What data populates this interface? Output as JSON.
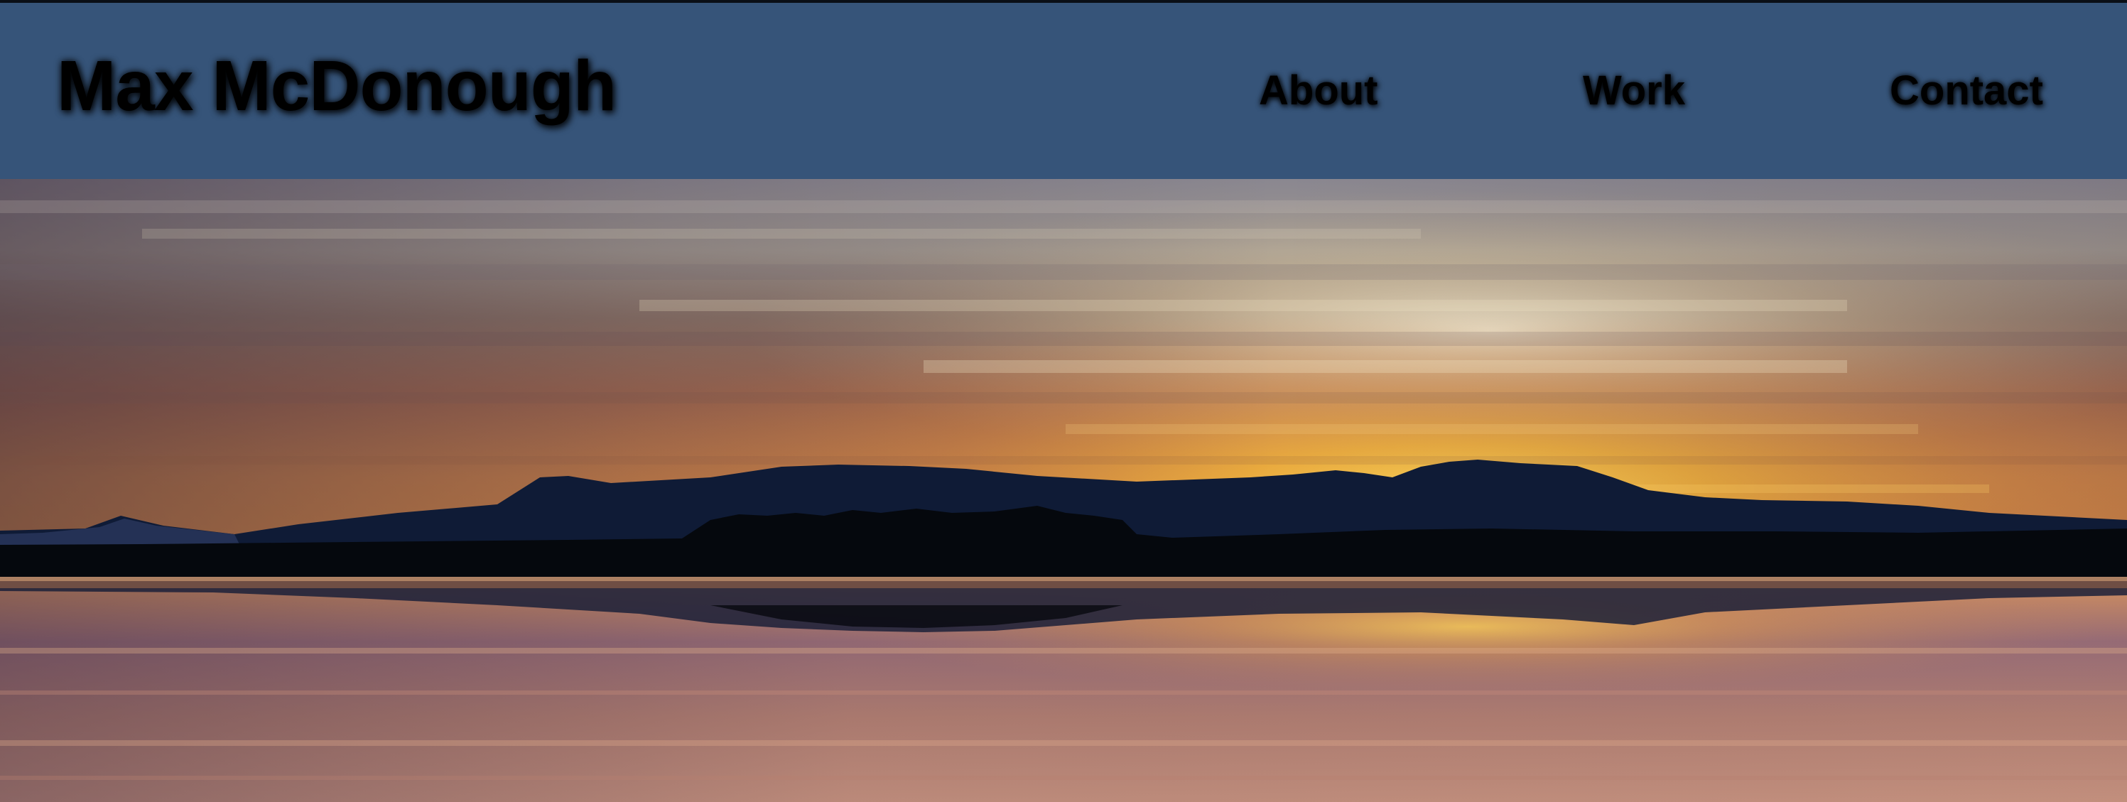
{
  "site": {
    "title": "Max McDonough"
  },
  "nav": {
    "items": [
      {
        "label": "About"
      },
      {
        "label": "Work"
      },
      {
        "label": "Contact"
      }
    ]
  },
  "hero": {
    "image": "sunset-lake-mountains-landscape"
  },
  "colors": {
    "navbar_bg": "#365479",
    "text": "#000000",
    "sky_top": "#7d7a85",
    "sun_glow": "#f5c242",
    "mountains": "#101c38",
    "treeline": "#05080d",
    "water_warm": "#c98a62"
  }
}
